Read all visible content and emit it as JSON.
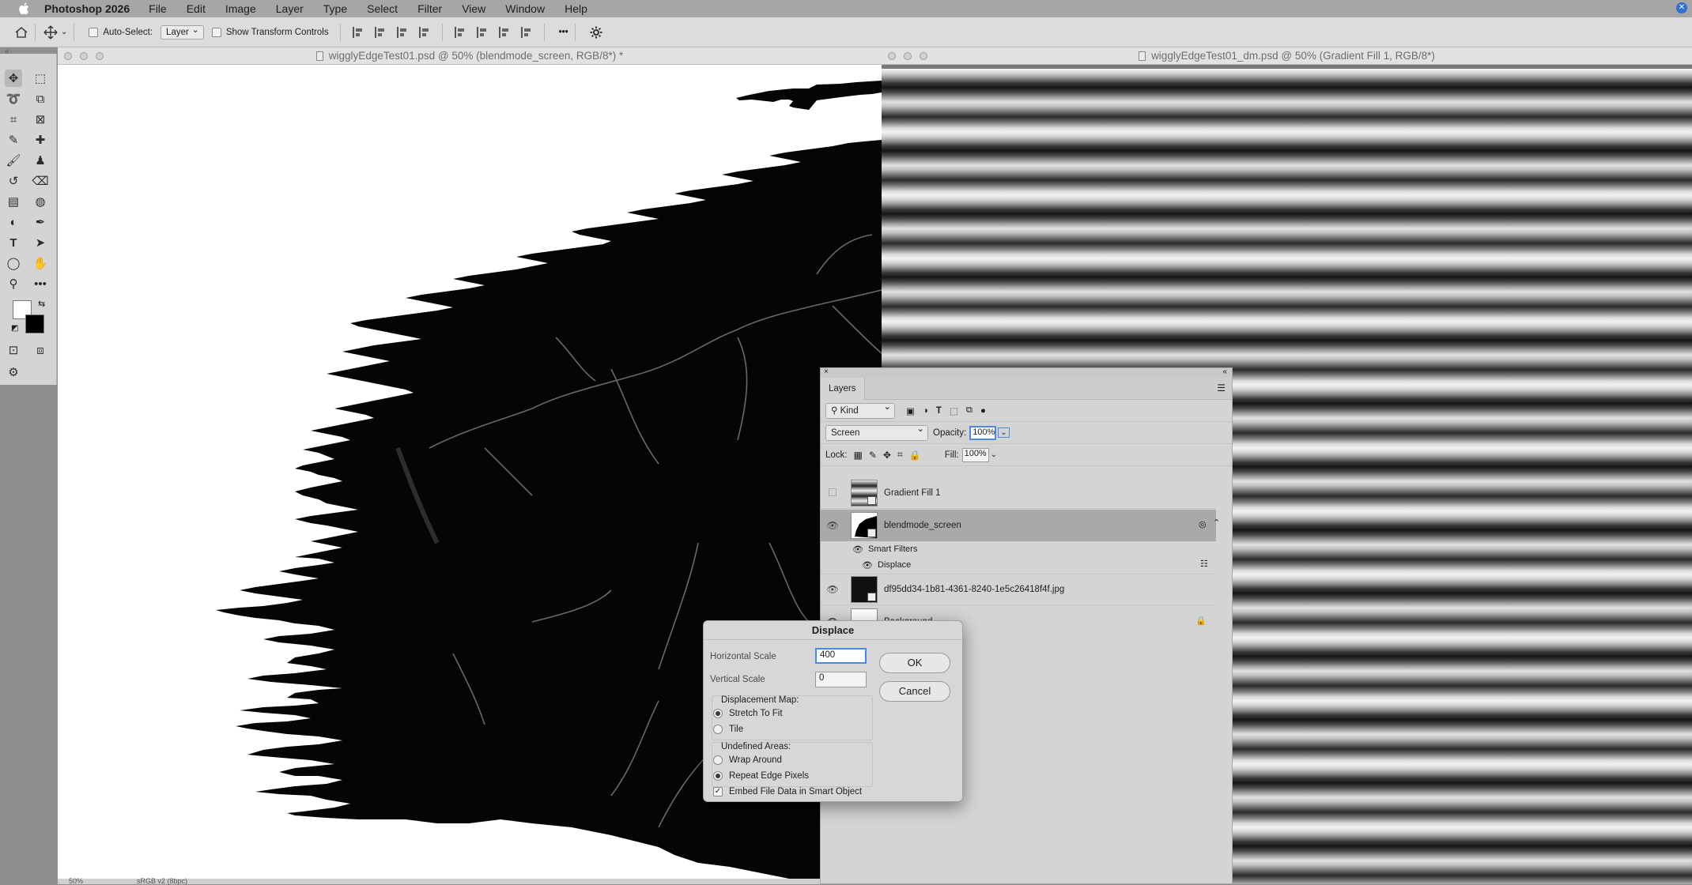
{
  "menubar": {
    "app_name": "Photoshop 2026",
    "items": [
      "File",
      "Edit",
      "Image",
      "Layer",
      "Type",
      "Select",
      "Filter",
      "View",
      "Window",
      "Help"
    ]
  },
  "options_bar": {
    "auto_select_label": "Auto-Select:",
    "auto_select_value": "Layer",
    "transform_controls_label": "Show Transform Controls",
    "more_label": "•••"
  },
  "documents": {
    "left_title": "wigglyEdgeTest01.psd @ 50% (blendmode_screen, RGB/8*) *",
    "right_title": "wigglyEdgeTest01_dm.psd @ 50% (Gradient Fill 1, RGB/8*)",
    "left_zoom": "50%",
    "left_profile": "sRGB v2 (8bpc)"
  },
  "layers_panel": {
    "tab": "Layers",
    "filter_kind": "Kind",
    "blend_mode": "Screen",
    "opacity_label": "Opacity:",
    "opacity_value": "100%",
    "lock_label": "Lock:",
    "fill_label": "Fill:",
    "fill_value": "100%",
    "layers": [
      {
        "name": "Gradient Fill 1"
      },
      {
        "name": "blendmode_screen"
      },
      {
        "name": "Smart Filters"
      },
      {
        "name": "Displace"
      },
      {
        "name": "df95dd34-1b81-4361-8240-1e5c26418f4f.jpg"
      },
      {
        "name": "Background"
      }
    ]
  },
  "dialog": {
    "title": "Displace",
    "horizontal_label": "Horizontal Scale",
    "horizontal_value": "400",
    "vertical_label": "Vertical Scale",
    "vertical_value": "0",
    "ok": "OK",
    "cancel": "Cancel",
    "map_label": "Displacement Map:",
    "map_options": [
      "Stretch To Fit",
      "Tile"
    ],
    "undefined_label": "Undefined Areas:",
    "undefined_options": [
      "Wrap Around",
      "Repeat Edge Pixels"
    ],
    "embed_label": "Embed File Data in Smart Object"
  },
  "icons": {
    "apple": "apple-icon",
    "home": "home-icon",
    "move": "move-icon",
    "settings": "gear-icon"
  }
}
